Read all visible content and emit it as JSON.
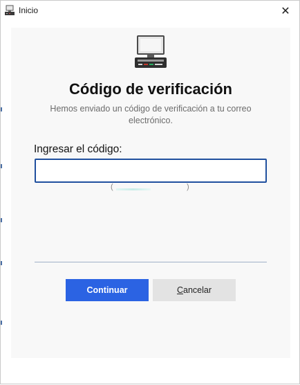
{
  "window": {
    "title": "Inicio",
    "close_glyph": "✕",
    "icon": "computer-terminal-icon"
  },
  "dialog": {
    "icon": "computer-terminal-icon",
    "heading": "Código de verificación",
    "subtitle": "Hemos enviado un código de verificación a tu correo electrónico.",
    "field_label": "Ingresar el código:",
    "code_value": "",
    "progress": {
      "open": "(",
      "close": ")",
      "fraction": 0.5
    },
    "continue_button": "Continuar",
    "cancel_first_letter": "C",
    "cancel_rest": "ancelar"
  },
  "colors": {
    "primary": "#2b63e3",
    "input_border": "#1f4f9e",
    "panel_bg": "#f8f8f8",
    "secondary_button": "#e3e3e3"
  }
}
